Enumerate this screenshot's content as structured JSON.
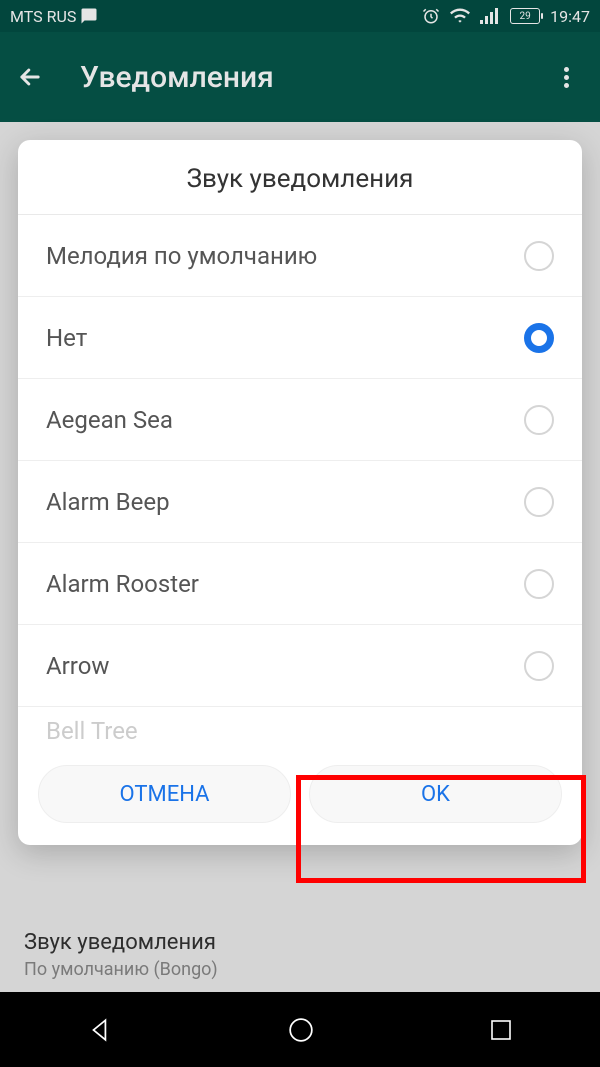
{
  "status": {
    "carrier": "MTS RUS",
    "battery_pct": "29",
    "time": "19:47"
  },
  "app_bar": {
    "title": "Уведомления"
  },
  "dialog": {
    "title": "Звук уведомления",
    "options": [
      {
        "label": "Мелодия по умолчанию",
        "selected": false
      },
      {
        "label": "Нет",
        "selected": true
      },
      {
        "label": "Aegean Sea",
        "selected": false
      },
      {
        "label": "Alarm Beep",
        "selected": false
      },
      {
        "label": "Alarm Rooster",
        "selected": false
      },
      {
        "label": "Arrow",
        "selected": false
      }
    ],
    "partial_option": "Bell Tree",
    "cancel": "ОТМЕНА",
    "ok": "OK"
  },
  "bg_setting": {
    "title": "Звук уведомления",
    "sub": "По умолчанию (Bongo)"
  }
}
